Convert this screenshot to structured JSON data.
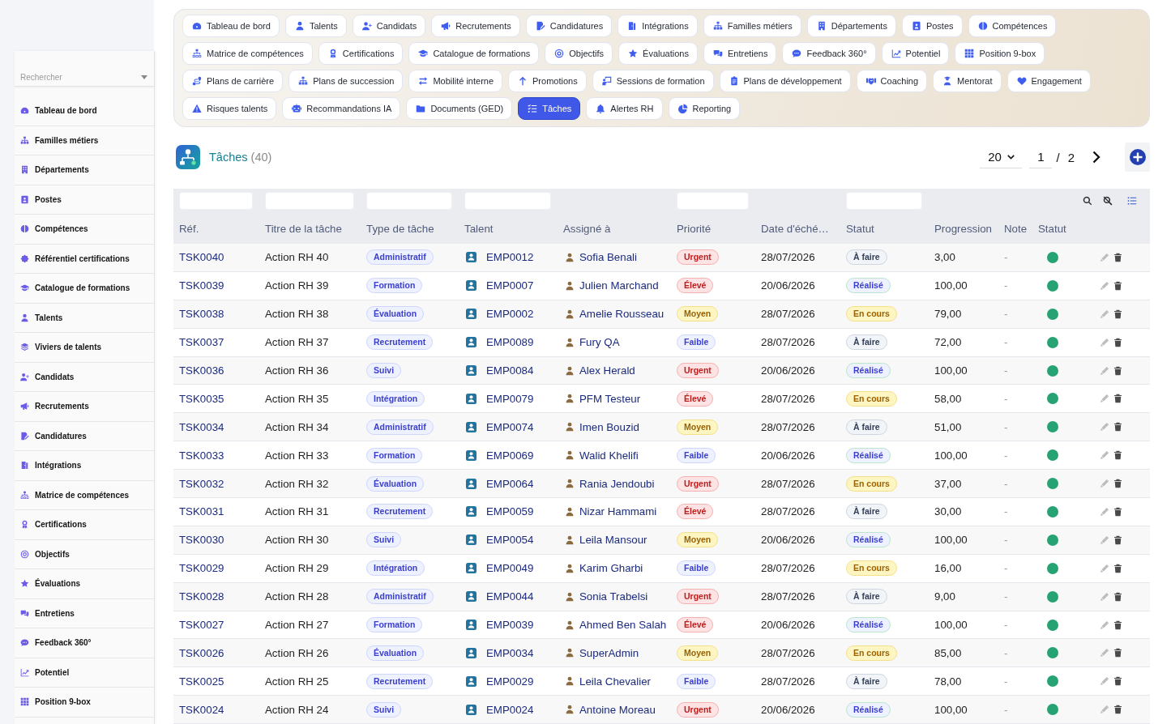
{
  "sidebar": {
    "search": {
      "placeholder": "Rechercher"
    },
    "items": [
      {
        "label": "Tableau de bord",
        "selected": false
      },
      {
        "label": "Familles métiers",
        "selected": false
      },
      {
        "label": "Départements",
        "selected": false
      },
      {
        "label": "Postes",
        "selected": false
      },
      {
        "label": "Compétences",
        "selected": false
      },
      {
        "label": "Référentiel certifications",
        "selected": false
      },
      {
        "label": "Catalogue de formations",
        "selected": false
      },
      {
        "label": "Talents",
        "selected": false
      },
      {
        "label": "Viviers de talents",
        "selected": false
      },
      {
        "label": "Candidats",
        "selected": false
      },
      {
        "label": "Recrutements",
        "selected": false
      },
      {
        "label": "Candidatures",
        "selected": false
      },
      {
        "label": "Intégrations",
        "selected": false
      },
      {
        "label": "Matrice de compétences",
        "selected": false
      },
      {
        "label": "Certifications",
        "selected": false
      },
      {
        "label": "Objectifs",
        "selected": false
      },
      {
        "label": "Évaluations",
        "selected": false
      },
      {
        "label": "Entretiens",
        "selected": false
      },
      {
        "label": "Feedback 360°",
        "selected": false
      },
      {
        "label": "Potentiel",
        "selected": false
      },
      {
        "label": "Position 9-box",
        "selected": false
      }
    ]
  },
  "nav": {
    "items": [
      {
        "label": "Tableau de bord",
        "selected": false
      },
      {
        "label": "Talents",
        "selected": false
      },
      {
        "label": "Candidats",
        "selected": false
      },
      {
        "label": "Recrutements",
        "selected": false
      },
      {
        "label": "Candidatures",
        "selected": false
      },
      {
        "label": "Intégrations",
        "selected": false
      },
      {
        "label": "Familles métiers",
        "selected": false
      },
      {
        "label": "Départements",
        "selected": false
      },
      {
        "label": "Postes",
        "selected": false
      },
      {
        "label": "Compétences",
        "selected": false
      },
      {
        "label": "Matrice de compétences",
        "selected": false
      },
      {
        "label": "Certifications",
        "selected": false
      },
      {
        "label": "Catalogue de formations",
        "selected": false
      },
      {
        "label": "Objectifs",
        "selected": false
      },
      {
        "label": "Évaluations",
        "selected": false
      },
      {
        "label": "Entretiens",
        "selected": false
      },
      {
        "label": "Feedback 360°",
        "selected": false
      },
      {
        "label": "Potentiel",
        "selected": false
      },
      {
        "label": "Position 9-box",
        "selected": false
      },
      {
        "label": "Plans de carrière",
        "selected": false
      },
      {
        "label": "Plans de succession",
        "selected": false
      },
      {
        "label": "Mobilité interne",
        "selected": false
      },
      {
        "label": "Promotions",
        "selected": false
      },
      {
        "label": "Sessions de formation",
        "selected": false
      },
      {
        "label": "Plans de développement",
        "selected": false
      },
      {
        "label": "Coaching",
        "selected": false
      },
      {
        "label": "Mentorat",
        "selected": false
      },
      {
        "label": "Engagement",
        "selected": false
      },
      {
        "label": "Risques talents",
        "selected": false
      },
      {
        "label": "Recommandations IA",
        "selected": false
      },
      {
        "label": "Documents (GED)",
        "selected": false
      },
      {
        "label": "Tâches",
        "selected": true
      },
      {
        "label": "Alertes RH",
        "selected": false
      },
      {
        "label": "Reporting",
        "selected": false
      }
    ]
  },
  "header": {
    "title": "Tâches",
    "count": "(40)"
  },
  "pagination": {
    "page_size": "20",
    "page": "1",
    "separator": "/",
    "total_pages": "2"
  },
  "table": {
    "columns": [
      {
        "label": "Réf.",
        "filter": true
      },
      {
        "label": "Titre de la tâche",
        "filter": true
      },
      {
        "label": "Type de tâche",
        "filter": true
      },
      {
        "label": "Talent",
        "filter": true
      },
      {
        "label": "Assigné à",
        "filter": false
      },
      {
        "label": "Priorité",
        "filter": true
      },
      {
        "label": "Date d'éché…",
        "filter": false
      },
      {
        "label": "Statut",
        "filter": true
      },
      {
        "label": "Progression",
        "filter": false
      },
      {
        "label": "Note",
        "filter": false
      },
      {
        "label": "Statut",
        "filter": false
      }
    ],
    "rows": [
      {
        "ref": "TSK0040",
        "title": "Action RH 40",
        "type": "Administratif",
        "talent": "EMP0012",
        "assignee": "Sofia Benali",
        "priority": {
          "label": "Urgent",
          "kind": "urgent"
        },
        "due_date": "28/07/2026",
        "status": {
          "label": "À faire",
          "kind": "todo"
        },
        "progress": "3,00",
        "note": "-",
        "active": true
      },
      {
        "ref": "TSK0039",
        "title": "Action RH 39",
        "type": "Formation",
        "talent": "EMP0007",
        "assignee": "Julien Marchand",
        "priority": {
          "label": "Élevé",
          "kind": "high"
        },
        "due_date": "20/06/2026",
        "status": {
          "label": "Réalisé",
          "kind": "done"
        },
        "progress": "100,00",
        "note": "-",
        "active": true
      },
      {
        "ref": "TSK0038",
        "title": "Action RH 38",
        "type": "Évaluation",
        "talent": "EMP0002",
        "assignee": "Amelie Rousseau",
        "priority": {
          "label": "Moyen",
          "kind": "medium"
        },
        "due_date": "28/07/2026",
        "status": {
          "label": "En cours",
          "kind": "in_progress"
        },
        "progress": "79,00",
        "note": "-",
        "active": true
      },
      {
        "ref": "TSK0037",
        "title": "Action RH 37",
        "type": "Recrutement",
        "talent": "EMP0089",
        "assignee": "Fury QA",
        "priority": {
          "label": "Faible",
          "kind": "low"
        },
        "due_date": "28/07/2026",
        "status": {
          "label": "À faire",
          "kind": "todo"
        },
        "progress": "72,00",
        "note": "-",
        "active": true
      },
      {
        "ref": "TSK0036",
        "title": "Action RH 36",
        "type": "Suivi",
        "talent": "EMP0084",
        "assignee": "Alex Herald",
        "priority": {
          "label": "Urgent",
          "kind": "urgent"
        },
        "due_date": "20/06/2026",
        "status": {
          "label": "Réalisé",
          "kind": "done"
        },
        "progress": "100,00",
        "note": "-",
        "active": true
      },
      {
        "ref": "TSK0035",
        "title": "Action RH 35",
        "type": "Intégration",
        "talent": "EMP0079",
        "assignee": "PFM Testeur",
        "priority": {
          "label": "Élevé",
          "kind": "high"
        },
        "due_date": "28/07/2026",
        "status": {
          "label": "En cours",
          "kind": "in_progress"
        },
        "progress": "58,00",
        "note": "-",
        "active": true
      },
      {
        "ref": "TSK0034",
        "title": "Action RH 34",
        "type": "Administratif",
        "talent": "EMP0074",
        "assignee": "Imen Bouzid",
        "priority": {
          "label": "Moyen",
          "kind": "medium"
        },
        "due_date": "28/07/2026",
        "status": {
          "label": "À faire",
          "kind": "todo"
        },
        "progress": "51,00",
        "note": "-",
        "active": true
      },
      {
        "ref": "TSK0033",
        "title": "Action RH 33",
        "type": "Formation",
        "talent": "EMP0069",
        "assignee": "Walid Khelifi",
        "priority": {
          "label": "Faible",
          "kind": "low"
        },
        "due_date": "20/06/2026",
        "status": {
          "label": "Réalisé",
          "kind": "done"
        },
        "progress": "100,00",
        "note": "-",
        "active": true
      },
      {
        "ref": "TSK0032",
        "title": "Action RH 32",
        "type": "Évaluation",
        "talent": "EMP0064",
        "assignee": "Rania Jendoubi",
        "priority": {
          "label": "Urgent",
          "kind": "urgent"
        },
        "due_date": "28/07/2026",
        "status": {
          "label": "En cours",
          "kind": "in_progress"
        },
        "progress": "37,00",
        "note": "-",
        "active": true
      },
      {
        "ref": "TSK0031",
        "title": "Action RH 31",
        "type": "Recrutement",
        "talent": "EMP0059",
        "assignee": "Nizar Hammami",
        "priority": {
          "label": "Élevé",
          "kind": "high"
        },
        "due_date": "28/07/2026",
        "status": {
          "label": "À faire",
          "kind": "todo"
        },
        "progress": "30,00",
        "note": "-",
        "active": true
      },
      {
        "ref": "TSK0030",
        "title": "Action RH 30",
        "type": "Suivi",
        "talent": "EMP0054",
        "assignee": "Leila Mansour",
        "priority": {
          "label": "Moyen",
          "kind": "medium"
        },
        "due_date": "20/06/2026",
        "status": {
          "label": "Réalisé",
          "kind": "done"
        },
        "progress": "100,00",
        "note": "-",
        "active": true
      },
      {
        "ref": "TSK0029",
        "title": "Action RH 29",
        "type": "Intégration",
        "talent": "EMP0049",
        "assignee": "Karim Gharbi",
        "priority": {
          "label": "Faible",
          "kind": "low"
        },
        "due_date": "28/07/2026",
        "status": {
          "label": "En cours",
          "kind": "in_progress"
        },
        "progress": "16,00",
        "note": "-",
        "active": true
      },
      {
        "ref": "TSK0028",
        "title": "Action RH 28",
        "type": "Administratif",
        "talent": "EMP0044",
        "assignee": "Sonia Trabelsi",
        "priority": {
          "label": "Urgent",
          "kind": "urgent"
        },
        "due_date": "28/07/2026",
        "status": {
          "label": "À faire",
          "kind": "todo"
        },
        "progress": "9,00",
        "note": "-",
        "active": true
      },
      {
        "ref": "TSK0027",
        "title": "Action RH 27",
        "type": "Formation",
        "talent": "EMP0039",
        "assignee": "Ahmed Ben Salah",
        "priority": {
          "label": "Élevé",
          "kind": "high"
        },
        "due_date": "20/06/2026",
        "status": {
          "label": "Réalisé",
          "kind": "done"
        },
        "progress": "100,00",
        "note": "-",
        "active": true
      },
      {
        "ref": "TSK0026",
        "title": "Action RH 26",
        "type": "Évaluation",
        "talent": "EMP0034",
        "assignee": "SuperAdmin",
        "priority": {
          "label": "Moyen",
          "kind": "medium"
        },
        "due_date": "28/07/2026",
        "status": {
          "label": "En cours",
          "kind": "in_progress"
        },
        "progress": "85,00",
        "note": "-",
        "active": true
      },
      {
        "ref": "TSK0025",
        "title": "Action RH 25",
        "type": "Recrutement",
        "talent": "EMP0029",
        "assignee": "Leila Chevalier",
        "priority": {
          "label": "Faible",
          "kind": "low"
        },
        "due_date": "28/07/2026",
        "status": {
          "label": "À faire",
          "kind": "todo"
        },
        "progress": "78,00",
        "note": "-",
        "active": true
      },
      {
        "ref": "TSK0024",
        "title": "Action RH 24",
        "type": "Suivi",
        "talent": "EMP0024",
        "assignee": "Antoine Moreau",
        "priority": {
          "label": "Urgent",
          "kind": "urgent"
        },
        "due_date": "20/06/2026",
        "status": {
          "label": "Réalisé",
          "kind": "done"
        },
        "progress": "100,00",
        "note": "-",
        "active": true
      }
    ]
  }
}
